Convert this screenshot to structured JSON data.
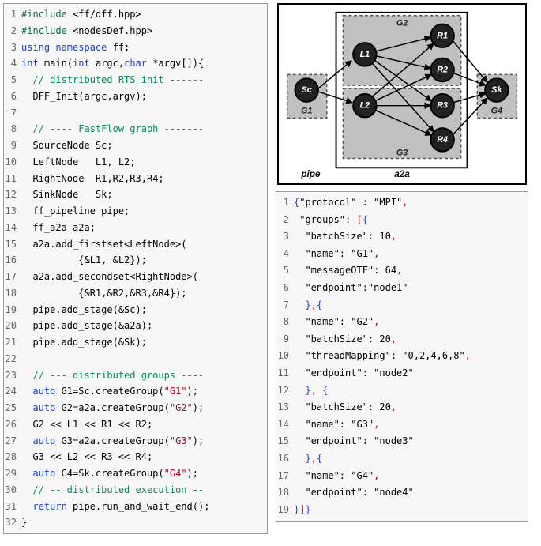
{
  "cpp_code": {
    "lines": [
      [
        {
          "t": "#include",
          "c": "tok-pre"
        },
        {
          "t": " <ff/dff.hpp>",
          "c": ""
        }
      ],
      [
        {
          "t": "#include",
          "c": "tok-pre"
        },
        {
          "t": " <nodesDef.hpp>",
          "c": ""
        }
      ],
      [
        {
          "t": "using namespace",
          "c": "tok-kw"
        },
        {
          "t": " ff;",
          "c": ""
        }
      ],
      [
        {
          "t": "int",
          "c": "tok-kw"
        },
        {
          "t": " main(",
          "c": ""
        },
        {
          "t": "int",
          "c": "tok-kw"
        },
        {
          "t": " argc,",
          "c": ""
        },
        {
          "t": "char",
          "c": "tok-kw"
        },
        {
          "t": " *argv[]){",
          "c": ""
        }
      ],
      [
        {
          "t": "  ",
          "c": ""
        },
        {
          "t": "// distributed RTS init ------",
          "c": "tok-cmt"
        }
      ],
      [
        {
          "t": "  DFF_Init(argc,argv);",
          "c": ""
        }
      ],
      [
        {
          "t": "",
          "c": ""
        }
      ],
      [
        {
          "t": "  ",
          "c": ""
        },
        {
          "t": "// ---- FastFlow graph -------",
          "c": "tok-cmt"
        }
      ],
      [
        {
          "t": "  SourceNode Sc;",
          "c": ""
        }
      ],
      [
        {
          "t": "  LeftNode   L1, L2;",
          "c": ""
        }
      ],
      [
        {
          "t": "  RightNode  R1,R2,R3,R4;",
          "c": ""
        }
      ],
      [
        {
          "t": "  SinkNode   Sk;",
          "c": ""
        }
      ],
      [
        {
          "t": "  ff_pipeline pipe;",
          "c": ""
        }
      ],
      [
        {
          "t": "  ff_a2a a2a;",
          "c": ""
        }
      ],
      [
        {
          "t": "  a2a.add_firstset<LeftNode>(",
          "c": ""
        }
      ],
      [
        {
          "t": "          {&L1, &L2});",
          "c": ""
        }
      ],
      [
        {
          "t": "  a2a.add_secondset<RightNode>(",
          "c": ""
        }
      ],
      [
        {
          "t": "          {&R1,&R2,&R3,&R4});",
          "c": ""
        }
      ],
      [
        {
          "t": "  pipe.add_stage(&Sc);",
          "c": ""
        }
      ],
      [
        {
          "t": "  pipe.add_stage(&a2a);",
          "c": ""
        }
      ],
      [
        {
          "t": "  pipe.add_stage(&Sk);",
          "c": ""
        }
      ],
      [
        {
          "t": "",
          "c": ""
        }
      ],
      [
        {
          "t": "  ",
          "c": ""
        },
        {
          "t": "// --- distributed groups ----",
          "c": "tok-cmt"
        }
      ],
      [
        {
          "t": "  ",
          "c": ""
        },
        {
          "t": "auto",
          "c": "tok-kw"
        },
        {
          "t": " G1=Sc.createGroup(",
          "c": ""
        },
        {
          "t": "\"G1\"",
          "c": "tok-str"
        },
        {
          "t": ");",
          "c": ""
        }
      ],
      [
        {
          "t": "  ",
          "c": ""
        },
        {
          "t": "auto",
          "c": "tok-kw"
        },
        {
          "t": " G2=a2a.createGroup(",
          "c": ""
        },
        {
          "t": "\"G2\"",
          "c": "tok-str"
        },
        {
          "t": ");",
          "c": ""
        }
      ],
      [
        {
          "t": "  G2 << L1 << R1 << R2;",
          "c": ""
        }
      ],
      [
        {
          "t": "  ",
          "c": ""
        },
        {
          "t": "auto",
          "c": "tok-kw"
        },
        {
          "t": " G3=a2a.createGroup(",
          "c": ""
        },
        {
          "t": "\"G3\"",
          "c": "tok-str"
        },
        {
          "t": ");",
          "c": ""
        }
      ],
      [
        {
          "t": "  G3 << L2 << R3 << R4;",
          "c": ""
        }
      ],
      [
        {
          "t": "  ",
          "c": ""
        },
        {
          "t": "auto",
          "c": "tok-kw"
        },
        {
          "t": " G4=Sk.createGroup(",
          "c": ""
        },
        {
          "t": "\"G4\"",
          "c": "tok-str"
        },
        {
          "t": ");",
          "c": ""
        }
      ],
      [
        {
          "t": "  ",
          "c": ""
        },
        {
          "t": "// -- distributed execution --",
          "c": "tok-cmt"
        }
      ],
      [
        {
          "t": "  ",
          "c": ""
        },
        {
          "t": "return",
          "c": "tok-kw"
        },
        {
          "t": " pipe.run_and_wait_end();",
          "c": ""
        }
      ],
      [
        {
          "t": "}",
          "c": ""
        }
      ]
    ]
  },
  "json_config": {
    "lines": [
      [
        {
          "t": "{",
          "c": "tok-jsonkw"
        },
        {
          "t": "\"protocol\" : \"MPI\"",
          "c": ""
        },
        {
          "t": ",",
          "c": "tok-punct"
        }
      ],
      [
        {
          "t": " \"groups\": ",
          "c": ""
        },
        {
          "t": "[",
          "c": "tok-jsonbr"
        },
        {
          "t": "{",
          "c": "tok-jsonkw"
        }
      ],
      [
        {
          "t": "  \"batchSize\": 10",
          "c": ""
        },
        {
          "t": ",",
          "c": "tok-punct"
        }
      ],
      [
        {
          "t": "  \"name\": \"G1\"",
          "c": ""
        },
        {
          "t": ",",
          "c": "tok-punct"
        }
      ],
      [
        {
          "t": "  \"messageOTF\": 64",
          "c": ""
        },
        {
          "t": ",",
          "c": "tok-punct"
        }
      ],
      [
        {
          "t": "  \"endpoint\":\"node1\"",
          "c": ""
        }
      ],
      [
        {
          "t": "  ",
          "c": ""
        },
        {
          "t": "}",
          "c": "tok-jsonkw"
        },
        {
          "t": ",",
          "c": "tok-punct"
        },
        {
          "t": "{",
          "c": "tok-jsonkw"
        }
      ],
      [
        {
          "t": "  \"name\": \"G2\"",
          "c": ""
        },
        {
          "t": ",",
          "c": "tok-punct"
        }
      ],
      [
        {
          "t": "  \"batchSize\": 20",
          "c": ""
        },
        {
          "t": ",",
          "c": "tok-punct"
        }
      ],
      [
        {
          "t": "  \"threadMapping\": \"0,2,4,6,8\"",
          "c": ""
        },
        {
          "t": ",",
          "c": "tok-punct"
        }
      ],
      [
        {
          "t": "  \"endpoint\": \"node2\"",
          "c": ""
        }
      ],
      [
        {
          "t": "  ",
          "c": ""
        },
        {
          "t": "}",
          "c": "tok-jsonkw"
        },
        {
          "t": ", ",
          "c": "tok-punct"
        },
        {
          "t": "{",
          "c": "tok-jsonkw"
        }
      ],
      [
        {
          "t": "  \"batchSize\": 20",
          "c": ""
        },
        {
          "t": ",",
          "c": "tok-punct"
        }
      ],
      [
        {
          "t": "  \"name\": \"G3\"",
          "c": ""
        },
        {
          "t": ",",
          "c": "tok-punct"
        }
      ],
      [
        {
          "t": "  \"endpoint\": \"node3\"",
          "c": ""
        }
      ],
      [
        {
          "t": "  ",
          "c": ""
        },
        {
          "t": "}",
          "c": "tok-jsonkw"
        },
        {
          "t": ",",
          "c": "tok-punct"
        },
        {
          "t": "{",
          "c": "tok-jsonkw"
        }
      ],
      [
        {
          "t": "  \"name\": \"G4\"",
          "c": ""
        },
        {
          "t": ",",
          "c": "tok-punct"
        }
      ],
      [
        {
          "t": "  \"endpoint\": \"node4\"",
          "c": ""
        }
      ],
      [
        {
          "t": "}",
          "c": "tok-jsonkw"
        },
        {
          "t": "]",
          "c": "tok-jsonbr"
        },
        {
          "t": "}",
          "c": "tok-jsonkw"
        }
      ]
    ]
  },
  "diagram": {
    "labels": {
      "pipe": "pipe",
      "a2a": "a2a",
      "G1": "G1",
      "G2": "G2",
      "G3": "G3",
      "G4": "G4",
      "Sc": "Sc",
      "L1": "L1",
      "L2": "L2",
      "R1": "R1",
      "R2": "R2",
      "R3": "R3",
      "R4": "R4",
      "Sk": "Sk"
    }
  }
}
